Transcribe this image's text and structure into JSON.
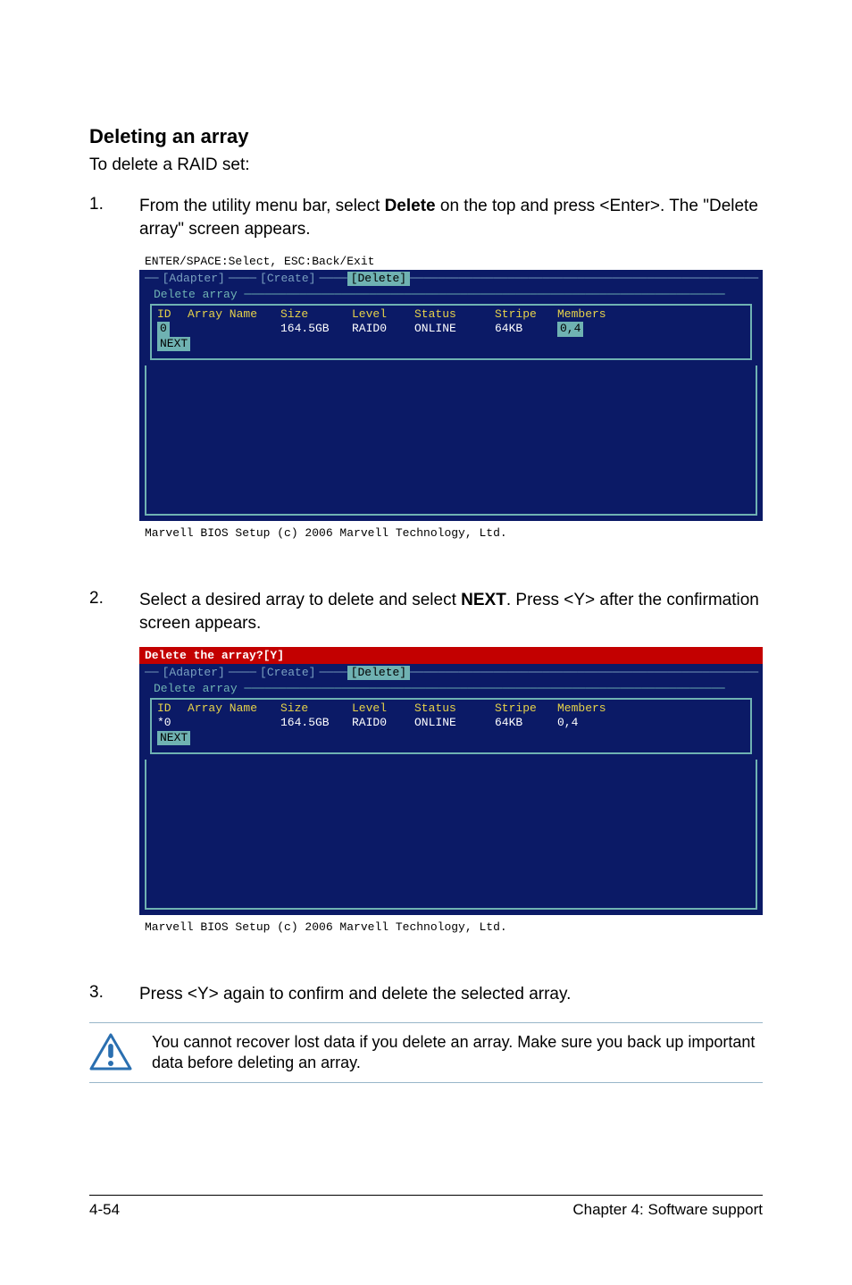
{
  "section_title": "Deleting an array",
  "intro": "To delete a RAID set:",
  "steps": {
    "s1": {
      "num": "1.",
      "pre": "From the utility menu bar, select ",
      "bold": "Delete",
      "post": " on the top and press <Enter>. The \"Delete array\" screen appears."
    },
    "s2": {
      "num": "2.",
      "pre": "Select a desired array to delete and select ",
      "bold": "NEXT",
      "post": ". Press <Y> after the confirmation screen appears."
    },
    "s3": {
      "num": "3.",
      "text": "Press <Y> again to confirm and delete the selected array."
    }
  },
  "bios_common": {
    "tabs": {
      "adapter": "[Adapter]",
      "create": "[Create]",
      "delete": "[Delete]"
    },
    "panel_label": "Delete array",
    "headers": {
      "id": "ID",
      "name": "Array Name",
      "size": "Size",
      "level": "Level",
      "status": "Status",
      "stripe": "Stripe",
      "members": "Members"
    },
    "footer": "Marvell BIOS Setup (c) 2006 Marvell Technology, Ltd."
  },
  "bios1": {
    "top": "ENTER/SPACE:Select, ESC:Back/Exit",
    "row": {
      "id": "0",
      "name": "",
      "size": "164.5GB",
      "level": "RAID0",
      "status": "ONLINE",
      "stripe": "64KB",
      "members": "0,4"
    },
    "next": "NEXT"
  },
  "bios2": {
    "top": "Delete the array?[Y]",
    "row": {
      "id": "*0",
      "name": "",
      "size": "164.5GB",
      "level": "RAID0",
      "status": "ONLINE",
      "stripe": "64KB",
      "members": "0,4"
    },
    "next": "NEXT"
  },
  "note": "You cannot recover lost data if you delete an array. Make sure you back up important data before deleting an array.",
  "footer": {
    "left": "4-54",
    "right": "Chapter 4: Software support"
  }
}
